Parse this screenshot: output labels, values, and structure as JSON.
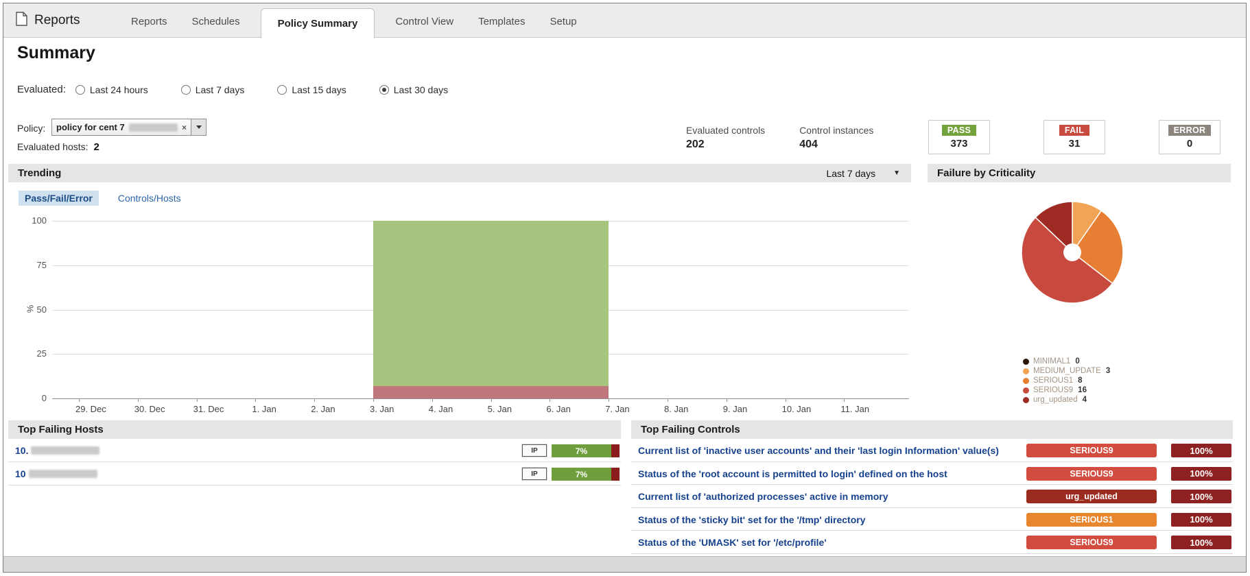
{
  "window": {
    "title": "Reports"
  },
  "icons": {
    "document": "page-outline",
    "caret_down": "▼",
    "clear": "×"
  },
  "nav": {
    "tabs": [
      {
        "label": "Reports",
        "active": false
      },
      {
        "label": "Schedules",
        "active": false
      },
      {
        "label": "Policy Summary",
        "active": true
      },
      {
        "label": "Control View",
        "active": false
      },
      {
        "label": "Templates",
        "active": false
      },
      {
        "label": "Setup",
        "active": false
      }
    ]
  },
  "summary": {
    "title": "Summary",
    "evaluated_label": "Evaluated:",
    "time_ranges": [
      {
        "label": "Last 24 hours",
        "selected": false
      },
      {
        "label": "Last 7 days",
        "selected": false
      },
      {
        "label": "Last 15 days",
        "selected": false
      },
      {
        "label": "Last 30 days",
        "selected": true
      }
    ],
    "policy_label": "Policy:",
    "policy_value": "policy for cent 7",
    "policy_value_redacted": true,
    "evaluated_hosts_label": "Evaluated hosts:",
    "evaluated_hosts_value": "2",
    "stats": [
      {
        "label": "Evaluated controls",
        "value": "202"
      },
      {
        "label": "Control instances",
        "value": "404"
      }
    ],
    "result_cards": [
      {
        "label": "PASS",
        "value": "373",
        "color": "#74a23c"
      },
      {
        "label": "FAIL",
        "value": "31",
        "color": "#c84b3f"
      },
      {
        "label": "ERROR",
        "value": "0",
        "color": "#8b857d"
      }
    ]
  },
  "trending": {
    "title": "Trending",
    "range_selector": "Last 7 days",
    "tabs": [
      {
        "label": "Pass/Fail/Error",
        "active": true
      },
      {
        "label": "Controls/Hosts",
        "active": false
      }
    ]
  },
  "criticality": {
    "title": "Failure by Criticality"
  },
  "chart_data": [
    {
      "type": "area",
      "title": "Pass/Fail/Error trend",
      "xlabel": "",
      "ylabel": "%",
      "ylim": [
        0,
        100
      ],
      "yticks": [
        0,
        25,
        50,
        75,
        100
      ],
      "grid": true,
      "legend_position": "none",
      "categories": [
        "29. Dec",
        "30. Dec",
        "31. Dec",
        "1. Jan",
        "2. Jan",
        "3. Jan",
        "4. Jan",
        "5. Jan",
        "6. Jan",
        "7. Jan",
        "8. Jan",
        "9. Jan",
        "10. Jan",
        "11. Jan"
      ],
      "series": [
        {
          "name": "Pass",
          "color": "#a8c57f",
          "values": [
            null,
            null,
            null,
            null,
            null,
            93,
            93,
            93,
            93,
            93,
            null,
            null,
            null,
            null
          ]
        },
        {
          "name": "Fail",
          "color": "#bf777d",
          "values": [
            null,
            null,
            null,
            null,
            null,
            7,
            7,
            7,
            7,
            7,
            null,
            null,
            null,
            null
          ]
        },
        {
          "name": "Error",
          "color": "#9a9a9a",
          "values": [
            null,
            null,
            null,
            null,
            null,
            0,
            0,
            0,
            0,
            0,
            null,
            null,
            null,
            null
          ]
        }
      ]
    },
    {
      "type": "pie",
      "donut": true,
      "title": "Failure by Criticality",
      "legend_position": "bottom",
      "labels": [
        "MINIMAL1",
        "MEDIUM_UPDATE",
        "SERIOUS1",
        "SERIOUS9",
        "urg_updated"
      ],
      "values": [
        0,
        3,
        8,
        16,
        4
      ],
      "colors": [
        "#2a1507",
        "#f2a355",
        "#e67e33",
        "#c84a3e",
        "#9d2b24"
      ]
    }
  ],
  "top_failing_hosts": {
    "title": "Top Failing Hosts",
    "rows": [
      {
        "host": "10.",
        "host_redacted": true,
        "tag": "IP",
        "fail_percent": "7%",
        "bar_color": "#6f9f3c",
        "bar_tip_color": "#8c1d1d"
      },
      {
        "host": "10",
        "host_redacted": true,
        "tag": "IP",
        "fail_percent": "7%",
        "bar_color": "#6f9f3c",
        "bar_tip_color": "#8c1d1d"
      }
    ]
  },
  "top_failing_controls": {
    "title": "Top Failing Controls",
    "rows": [
      {
        "name": "Current list of 'inactive user accounts' and their 'last login Information' value(s)",
        "criticality": "SERIOUS9",
        "criticality_color": "#d24c3f",
        "percent": "100%",
        "percent_color": "#8e2222"
      },
      {
        "name": "Status of the 'root account is permitted to login' defined on the host",
        "criticality": "SERIOUS9",
        "criticality_color": "#d24c3f",
        "percent": "100%",
        "percent_color": "#8e2222"
      },
      {
        "name": "Current list of 'authorized processes' active in memory",
        "criticality": "urg_updated",
        "criticality_color": "#9c2b1f",
        "percent": "100%",
        "percent_color": "#8e2222"
      },
      {
        "name": "Status of the 'sticky bit' set for the '/tmp' directory",
        "criticality": "SERIOUS1",
        "criticality_color": "#e8862e",
        "percent": "100%",
        "percent_color": "#8e2222"
      },
      {
        "name": "Status of the 'UMASK' set for '/etc/profile'",
        "criticality": "SERIOUS9",
        "criticality_color": "#d24c3f",
        "percent": "100%",
        "percent_color": "#8e2222"
      }
    ]
  }
}
